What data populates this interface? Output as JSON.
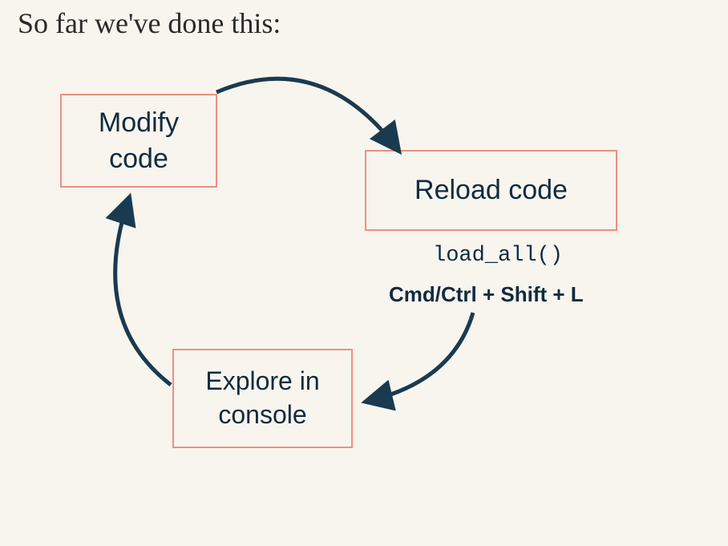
{
  "title": "So far we've done this:",
  "diagram": {
    "nodes": {
      "modify": {
        "label_line1": "Modify",
        "label_line2": "code"
      },
      "reload": {
        "label": "Reload code",
        "code": "load_all()",
        "shortcut": "Cmd/Ctrl + Shift + L"
      },
      "explore": {
        "label_line1": "Explore in",
        "label_line2": "console"
      }
    },
    "edges": [
      {
        "from": "modify",
        "to": "reload"
      },
      {
        "from": "reload",
        "to": "explore"
      },
      {
        "from": "explore",
        "to": "modify"
      }
    ]
  },
  "style": {
    "background": "#f7f5ee",
    "box_border": "#f08e82",
    "text_color": "#112b3f",
    "arrow_color": "#1a3a50"
  }
}
